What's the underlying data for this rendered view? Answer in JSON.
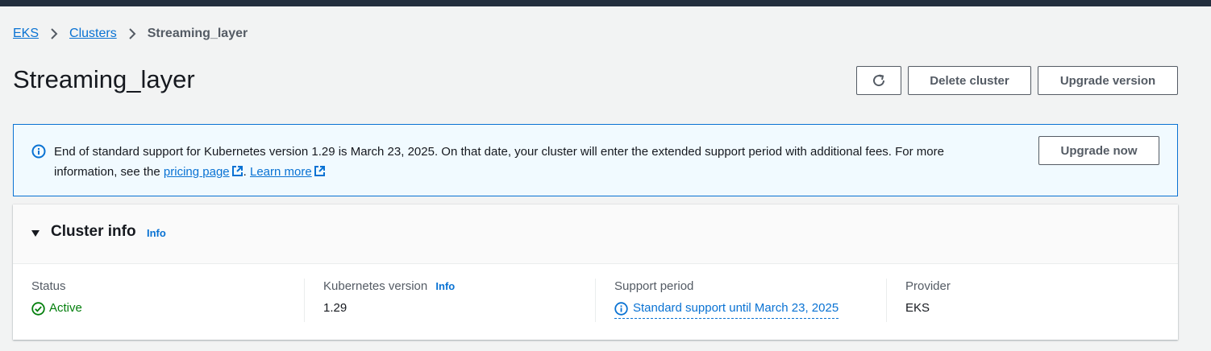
{
  "breadcrumb": {
    "items": [
      "EKS",
      "Clusters"
    ],
    "current": "Streaming_layer"
  },
  "page": {
    "title": "Streaming_layer"
  },
  "actions": {
    "delete_label": "Delete cluster",
    "upgrade_label": "Upgrade version"
  },
  "alert": {
    "text_part1": "End of standard support for Kubernetes version 1.29 is March 23, 2025. On that date, your cluster will enter the extended support period with additional fees. For more information, see the ",
    "pricing_link": "pricing page",
    "text_part2": ". ",
    "learn_more_link": "Learn more",
    "button_label": "Upgrade now"
  },
  "cluster_info": {
    "title": "Cluster info",
    "info_label": "Info",
    "status": {
      "label": "Status",
      "value": "Active"
    },
    "kubernetes": {
      "label": "Kubernetes version",
      "info_label": "Info",
      "value": "1.29"
    },
    "support": {
      "label": "Support period",
      "value": "Standard support until March 23, 2025"
    },
    "provider": {
      "label": "Provider",
      "value": "EKS"
    }
  },
  "icons": {
    "refresh": "refresh-icon",
    "info": "info-icon",
    "external": "external-link-icon",
    "caret": "caret-down-icon",
    "status": "check-circle-icon",
    "chevron": "chevron-right-icon"
  },
  "colors": {
    "link": "#0972d3",
    "success": "#037f0c",
    "alert_bg": "#f1faff",
    "topbar": "#232f3e"
  }
}
